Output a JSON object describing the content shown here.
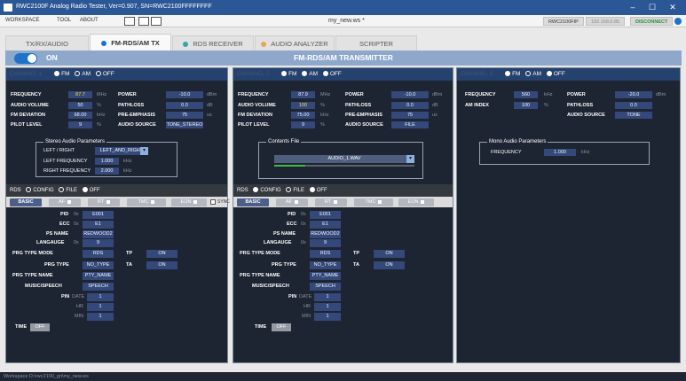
{
  "window": {
    "title": "RWC2100F Analog Radio Tester, Ver=0.907, SN=RWC2100FFFFFFFF",
    "minimize": "–",
    "maximize": "☐",
    "close": "✕"
  },
  "menu": {
    "items": [
      "WORKSPACE",
      "TOOL",
      "ABOUT"
    ],
    "workspace_file": "my_new.ws *",
    "device": "RWC2100FIP",
    "ip": "192.168.0.85",
    "disconnect": "DISCONNECT"
  },
  "tabs": [
    {
      "label": "TX/RX/AUDIO"
    },
    {
      "label": "FM-RDS/AM TX"
    },
    {
      "label": "RDS RECEIVER"
    },
    {
      "label": "AUDIO ANALYZER"
    },
    {
      "label": "SCRIPTER"
    }
  ],
  "header": {
    "power_label": "ON",
    "title": "FM-RDS/AM TRANSMITTER"
  },
  "channels": [
    {
      "name": "CHANNEL 1",
      "mode_fm": "FM",
      "mode_am": "AM",
      "mode_off": "OFF",
      "frequency": {
        "label": "FREQUENCY",
        "value": "87.7",
        "unit": "MHz"
      },
      "audio_volume": {
        "label": "AUDIO VOLUME",
        "value": "50",
        "unit": "%"
      },
      "fm_deviation": {
        "label": "FM DEVIATION",
        "value": "68.00",
        "unit": "kHz"
      },
      "pilot_level": {
        "label": "PILOT LEVEL",
        "value": "9",
        "unit": "%"
      },
      "power": {
        "label": "POWER",
        "value": "-10.0",
        "unit": "dBm"
      },
      "pathloss": {
        "label": "PATHLOSS",
        "value": "0.0",
        "unit": "dB"
      },
      "pre_emphasis": {
        "label": "PRE-EMPHASIS",
        "value": "75",
        "unit": "us"
      },
      "audio_source": {
        "label": "AUDIO SOURCE",
        "value": "TONE_STEREO"
      },
      "group": {
        "title": "Stereo Audio Parameters",
        "lr_label": "LEFT / RIGHT",
        "lr_value": "LEFT_AND_RIGHT",
        "left_label": "LEFT FREQUENCY",
        "left_value": "1.000",
        "left_unit": "kHz",
        "right_label": "RIGHT FREQUENCY",
        "right_value": "2.000",
        "right_unit": "kHz"
      }
    },
    {
      "name": "CHANNEL 2",
      "mode_fm": "FM",
      "mode_am": "AM",
      "mode_off": "OFF",
      "frequency": {
        "label": "FREQUENCY",
        "value": "87.9",
        "unit": "MHz"
      },
      "audio_volume": {
        "label": "AUDIO VOLUME",
        "value": "100",
        "unit": "%"
      },
      "fm_deviation": {
        "label": "FM DEVIATION",
        "value": "75.00",
        "unit": "kHz"
      },
      "pilot_level": {
        "label": "PILOT LEVEL",
        "value": "9",
        "unit": "%"
      },
      "power": {
        "label": "POWER",
        "value": "-10.0",
        "unit": "dBm"
      },
      "pathloss": {
        "label": "PATHLOSS",
        "value": "0.0",
        "unit": "dB"
      },
      "pre_emphasis": {
        "label": "PRE-EMPHASIS",
        "value": "75",
        "unit": "us"
      },
      "audio_source": {
        "label": "AUDIO SOURCE",
        "value": "FILE"
      },
      "group": {
        "title": "Contents File",
        "file": "AUDIO_1.WAV",
        "progress": 0.22
      }
    },
    {
      "name": "CHANNEL 3",
      "mode_fm": "FM",
      "mode_am": "AM",
      "mode_off": "OFF",
      "frequency": {
        "label": "FREQUENCY",
        "value": "560",
        "unit": "kHz"
      },
      "am_index": {
        "label": "AM INDEX",
        "value": "100",
        "unit": "%"
      },
      "power": {
        "label": "POWER",
        "value": "-20.0",
        "unit": "dBm"
      },
      "pathloss": {
        "label": "PATHLOSS",
        "value": "0.0"
      },
      "audio_source": {
        "label": "AUDIO SOURCE",
        "value": "TONE"
      },
      "group": {
        "title": "Mono Audio Parameters",
        "freq_label": "FREQUENCY",
        "freq_value": "1.000",
        "freq_unit": "kHz"
      }
    }
  ],
  "rds": {
    "label": "RDS",
    "config": "CONFIG",
    "file": "FILE",
    "off": "OFF",
    "tabs": {
      "basic": "BASIC",
      "af": "AF",
      "rt": "RT",
      "tmc": "TMC",
      "eon": "EON",
      "sync": "SYNC"
    },
    "panels": [
      {
        "pid": "E001",
        "ecc": "E1",
        "ps_name": "REDWOOD2",
        "language": "9",
        "prg_mode": "RDS",
        "prg_type": "NO_TYPE",
        "prg_type_name": "PTY_NAME",
        "music_speech": "SPEECH",
        "date": "1",
        "hr": "1",
        "min": "1",
        "tp": "ON",
        "ta": "ON",
        "time": "OFF"
      },
      {
        "pid": "E001",
        "ecc": "E1",
        "ps_name": "REDWOOD2",
        "language": "9",
        "prg_mode": "RDS",
        "prg_type": "NO_TYPE",
        "prg_type_name": "PTY_NAME",
        "music_speech": "SPEECH",
        "date": "1",
        "hr": "1",
        "min": "1",
        "tp": "ON",
        "ta": "ON",
        "time": "OFF"
      }
    ],
    "labels": {
      "pid": "PID",
      "ecc": "ECC",
      "ps_name": "PS NAME",
      "language": "LANGAUGE",
      "prg_mode": "PRG TYPE MODE",
      "prg_type": "PRG TYPE",
      "prg_type_name": "PRG TYPE NAME",
      "music_speech": "MUSIC/SPEECH",
      "pin": "PIN",
      "date": "DATE",
      "hr": "HR",
      "min": "MIN",
      "tp": "TP",
      "ta": "TA",
      "time": "TIME",
      "hex": "0x"
    }
  },
  "status": {
    "path": "Workspace  D:\\rwc2100_gri\\my_new.ws"
  },
  "colors": {
    "titlebar": "#2b5797",
    "panel_bg": "#1d2432",
    "field_bg": "#34497a",
    "header_bar": "#8ea8cc",
    "accent": "#1e73c8"
  }
}
